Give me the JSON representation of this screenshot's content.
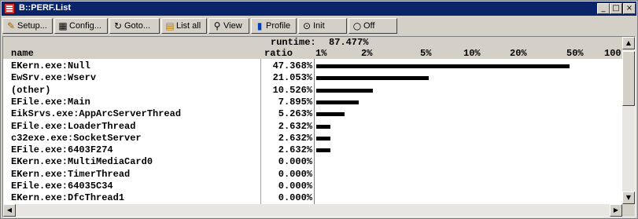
{
  "window": {
    "title": "B::PERF.List",
    "controls": {
      "minimize": "_",
      "maximize": "□",
      "close": "×"
    }
  },
  "toolbar": [
    {
      "label": "Setup...",
      "icon": "wrench-icon"
    },
    {
      "label": "Config...",
      "icon": "grid-icon"
    },
    {
      "label": "Goto...",
      "icon": "goto-icon"
    },
    {
      "label": "List all",
      "icon": "list-icon"
    },
    {
      "label": "View",
      "icon": "magnifier-icon"
    },
    {
      "label": "Profile",
      "icon": "bar-chart-icon"
    },
    {
      "label": "Init",
      "icon": "init-icon"
    },
    {
      "label": "Off",
      "icon": "off-icon"
    }
  ],
  "summary": {
    "runtime_label": "runtime:",
    "runtime_value": "87.477%"
  },
  "columns": {
    "name": "name",
    "ratio": "ratio",
    "scale": [
      "1%",
      "2%",
      "5%",
      "10%",
      "20%",
      "50%",
      "100"
    ]
  },
  "rows": [
    {
      "name": "EKern.exe:Null",
      "ratio": "47.368%",
      "value": 47.368
    },
    {
      "name": "EwSrv.exe:Wserv",
      "ratio": "21.053%",
      "value": 21.053
    },
    {
      "name": "(other)",
      "ratio": "10.526%",
      "value": 10.526
    },
    {
      "name": "EFile.exe:Main",
      "ratio": "7.895%",
      "value": 7.895
    },
    {
      "name": "EikSrvs.exe:AppArcServerThread",
      "ratio": "5.263%",
      "value": 5.263
    },
    {
      "name": "EFile.exe:LoaderThread",
      "ratio": "2.632%",
      "value": 2.632
    },
    {
      "name": "c32exe.exe:SocketServer",
      "ratio": "2.632%",
      "value": 2.632
    },
    {
      "name": "EFile.exe:6403F274",
      "ratio": "2.632%",
      "value": 2.632
    },
    {
      "name": "EKern.exe:MultiMediaCard0",
      "ratio": "0.000%",
      "value": 0
    },
    {
      "name": "EKern.exe:TimerThread",
      "ratio": "0.000%",
      "value": 0
    },
    {
      "name": "EFile.exe:64035C34",
      "ratio": "0.000%",
      "value": 0
    },
    {
      "name": "EKern.exe:DfcThread1",
      "ratio": "0.000%",
      "value": 0
    }
  ],
  "colors": {
    "titlebar": "#0a246a",
    "bar": "#000000",
    "face": "#d4d0c8"
  }
}
